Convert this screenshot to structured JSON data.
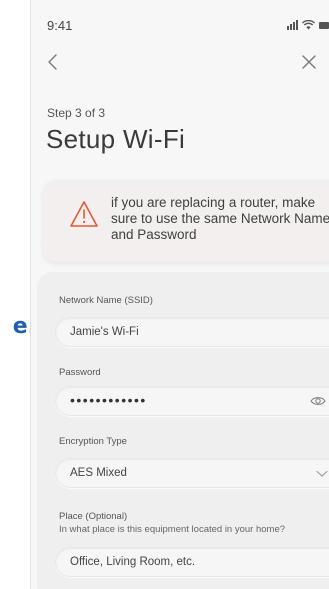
{
  "bleed_text": "e.",
  "status_bar": {
    "time": "9:41"
  },
  "header": {
    "step": "Step 3 of 3",
    "title": "Setup Wi-Fi"
  },
  "warning": {
    "text": "if you are replacing a router, make sure to use the same Network Name and Password",
    "icon": "warning-triangle-icon",
    "icon_color": "#e05a3a"
  },
  "form": {
    "ssid": {
      "label": "Network Name (SSID)",
      "value": "Jamie's Wi-Fi"
    },
    "password": {
      "label": "Password",
      "value": "••••••••••••"
    },
    "encryption": {
      "label": "Encryption Type",
      "value": "AES Mixed"
    },
    "place": {
      "label": "Place (Optional)",
      "hint": "In what place is this equipment located in your home?",
      "placeholder": "Office, Living Room, etc."
    }
  },
  "colors": {
    "accent": "#1f5fae",
    "warning": "#e05a3a"
  }
}
